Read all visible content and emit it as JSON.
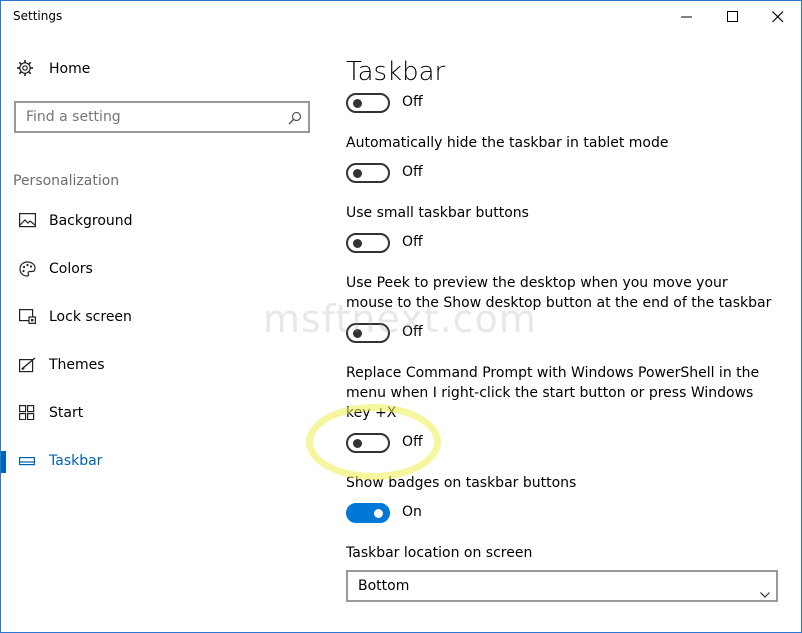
{
  "window": {
    "title": "Settings"
  },
  "sidebar": {
    "home_label": "Home",
    "search_placeholder": "Find a setting",
    "section_label": "Personalization",
    "items": [
      {
        "label": "Background",
        "icon": "picture-icon"
      },
      {
        "label": "Colors",
        "icon": "palette-icon"
      },
      {
        "label": "Lock screen",
        "icon": "lock-screen-icon"
      },
      {
        "label": "Themes",
        "icon": "themes-icon"
      },
      {
        "label": "Start",
        "icon": "start-icon"
      },
      {
        "label": "Taskbar",
        "icon": "taskbar-icon",
        "selected": true
      }
    ]
  },
  "main": {
    "title": "Taskbar",
    "settings": [
      {
        "label": "",
        "state": "Off",
        "on": false
      },
      {
        "label": "Automatically hide the taskbar in tablet mode",
        "state": "Off",
        "on": false
      },
      {
        "label": "Use small taskbar buttons",
        "state": "Off",
        "on": false
      },
      {
        "label": "Use Peek to preview the desktop when you move your mouse to the Show desktop button at the end of the taskbar",
        "state": "Off",
        "on": false
      },
      {
        "label": "Replace Command Prompt with Windows PowerShell in the menu when I right-click the start button or press Windows key +X",
        "state": "Off",
        "on": false
      },
      {
        "label": "Show badges on taskbar buttons",
        "state": "On",
        "on": true
      }
    ],
    "location_label": "Taskbar location on screen",
    "location_value": "Bottom"
  },
  "watermark": "msftnext.com",
  "colors": {
    "accent": "#0078d7",
    "selected_text": "#0063b1",
    "highlight": "#eeee50"
  }
}
